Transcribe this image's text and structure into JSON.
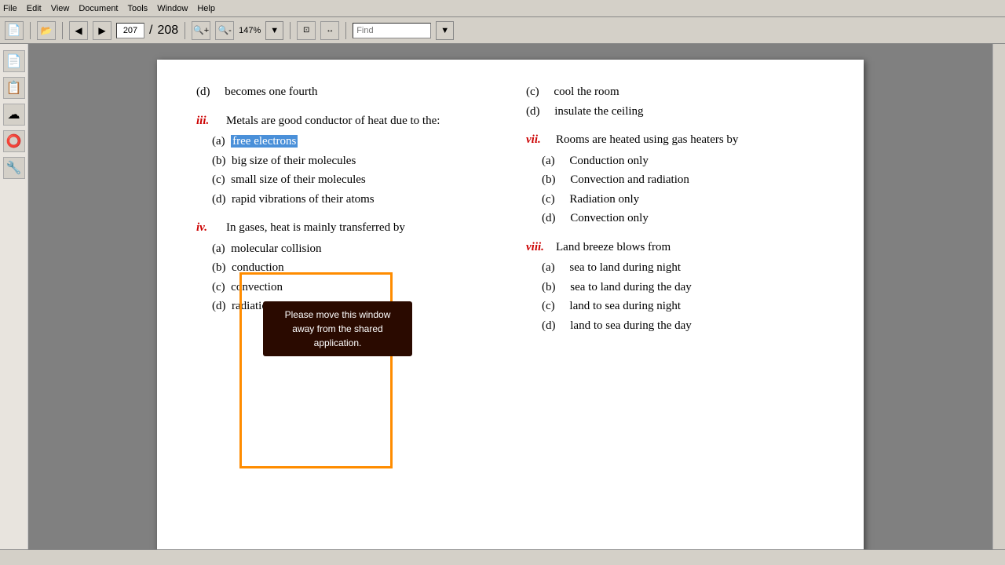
{
  "menu": {
    "items": [
      "File",
      "Edit",
      "View",
      "Document",
      "Tools",
      "Window",
      "Help"
    ]
  },
  "toolbar": {
    "page_current": "207",
    "page_total": "208",
    "zoom": "147%",
    "find_placeholder": "Find"
  },
  "left_column": {
    "question_d_becomes": {
      "option": "(d)",
      "text": "becomes one fourth"
    },
    "question_iii": {
      "num": "iii.",
      "text": "Metals are good conductor of heat due to the:",
      "options": [
        {
          "id": "(a)",
          "text": "free electrons",
          "highlighted": true
        },
        {
          "id": "(b)",
          "text": "big size of their molecules"
        },
        {
          "id": "(c)",
          "text": "small size of their molecules"
        },
        {
          "id": "(d)",
          "text": "rapid vibrations of their atoms"
        }
      ]
    },
    "question_iv": {
      "num": "iv.",
      "text": "In gases, heat is mainly transferred by",
      "options": [
        {
          "id": "(a)",
          "text": "molecular collision"
        },
        {
          "id": "(b)",
          "text": "conduction"
        },
        {
          "id": "(c)",
          "text": "convection"
        },
        {
          "id": "(d)",
          "text": "radiation"
        }
      ]
    }
  },
  "right_column": {
    "question_c_cool": {
      "option": "(c)",
      "text": "cool the room"
    },
    "question_d_insulate": {
      "option": "(d)",
      "text": "insulate the ceiling"
    },
    "question_vii": {
      "num": "vii.",
      "text": "Rooms are heated using gas heaters by",
      "options": [
        {
          "id": "(a)",
          "text": "Conduction only"
        },
        {
          "id": "(b)",
          "text": "Convection and radiation"
        },
        {
          "id": "(c)",
          "text": "Radiation only"
        },
        {
          "id": "(d)",
          "text": "Convection only"
        }
      ]
    },
    "question_viii": {
      "num": "viii.",
      "text": "Land breeze blows from",
      "options": [
        {
          "id": "(a)",
          "text": "sea to land during night"
        },
        {
          "id": "(b)",
          "text": "sea to land during the day"
        },
        {
          "id": "(c)",
          "text": "land to sea during night"
        },
        {
          "id": "(d)",
          "text": "land to sea during the day"
        }
      ]
    }
  },
  "warning": {
    "line1": "Please move this window",
    "line2": "away from the shared",
    "line3": "application."
  },
  "sidebar_icons": [
    "📄",
    "📋",
    "☁",
    "⭕",
    "🔧"
  ]
}
